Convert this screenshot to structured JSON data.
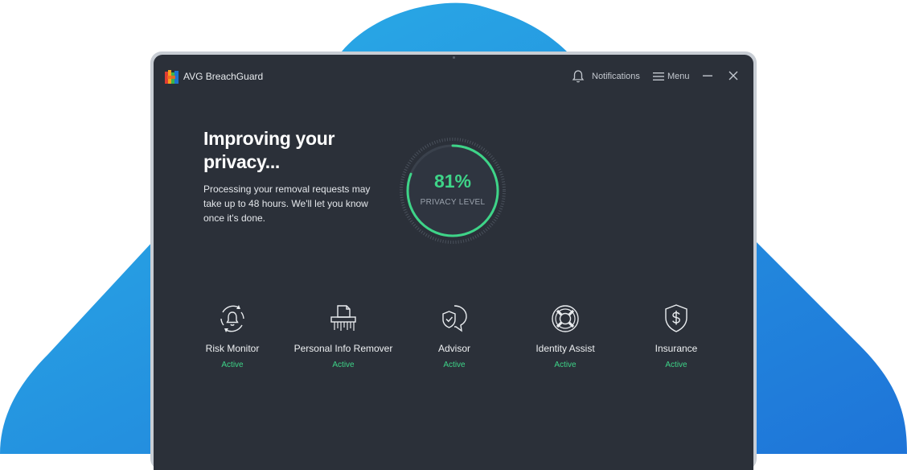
{
  "app": {
    "name": "AVG BreachGuard"
  },
  "titlebar": {
    "notifications_label": "Notifications",
    "menu_label": "Menu"
  },
  "main": {
    "headline": "Improving your privacy...",
    "subtext": "Processing your removal requests may take up to 48 hours. We'll let you know once it's done."
  },
  "gauge": {
    "percent": 81,
    "percent_text": "81%",
    "label": "PRIVACY LEVEL"
  },
  "features": [
    {
      "name": "Risk Monitor",
      "status": "Active",
      "icon": "bell-radar-icon"
    },
    {
      "name": "Personal Info Remover",
      "status": "Active",
      "icon": "shredder-icon"
    },
    {
      "name": "Advisor",
      "status": "Active",
      "icon": "chat-shield-icon"
    },
    {
      "name": "Identity Assist",
      "status": "Active",
      "icon": "lifebuoy-icon"
    },
    {
      "name": "Insurance",
      "status": "Active",
      "icon": "shield-dollar-icon"
    }
  ],
  "colors": {
    "background_blue": "#2aa3e0",
    "window_bg": "#2b3039",
    "accent_green": "#3ed488"
  }
}
